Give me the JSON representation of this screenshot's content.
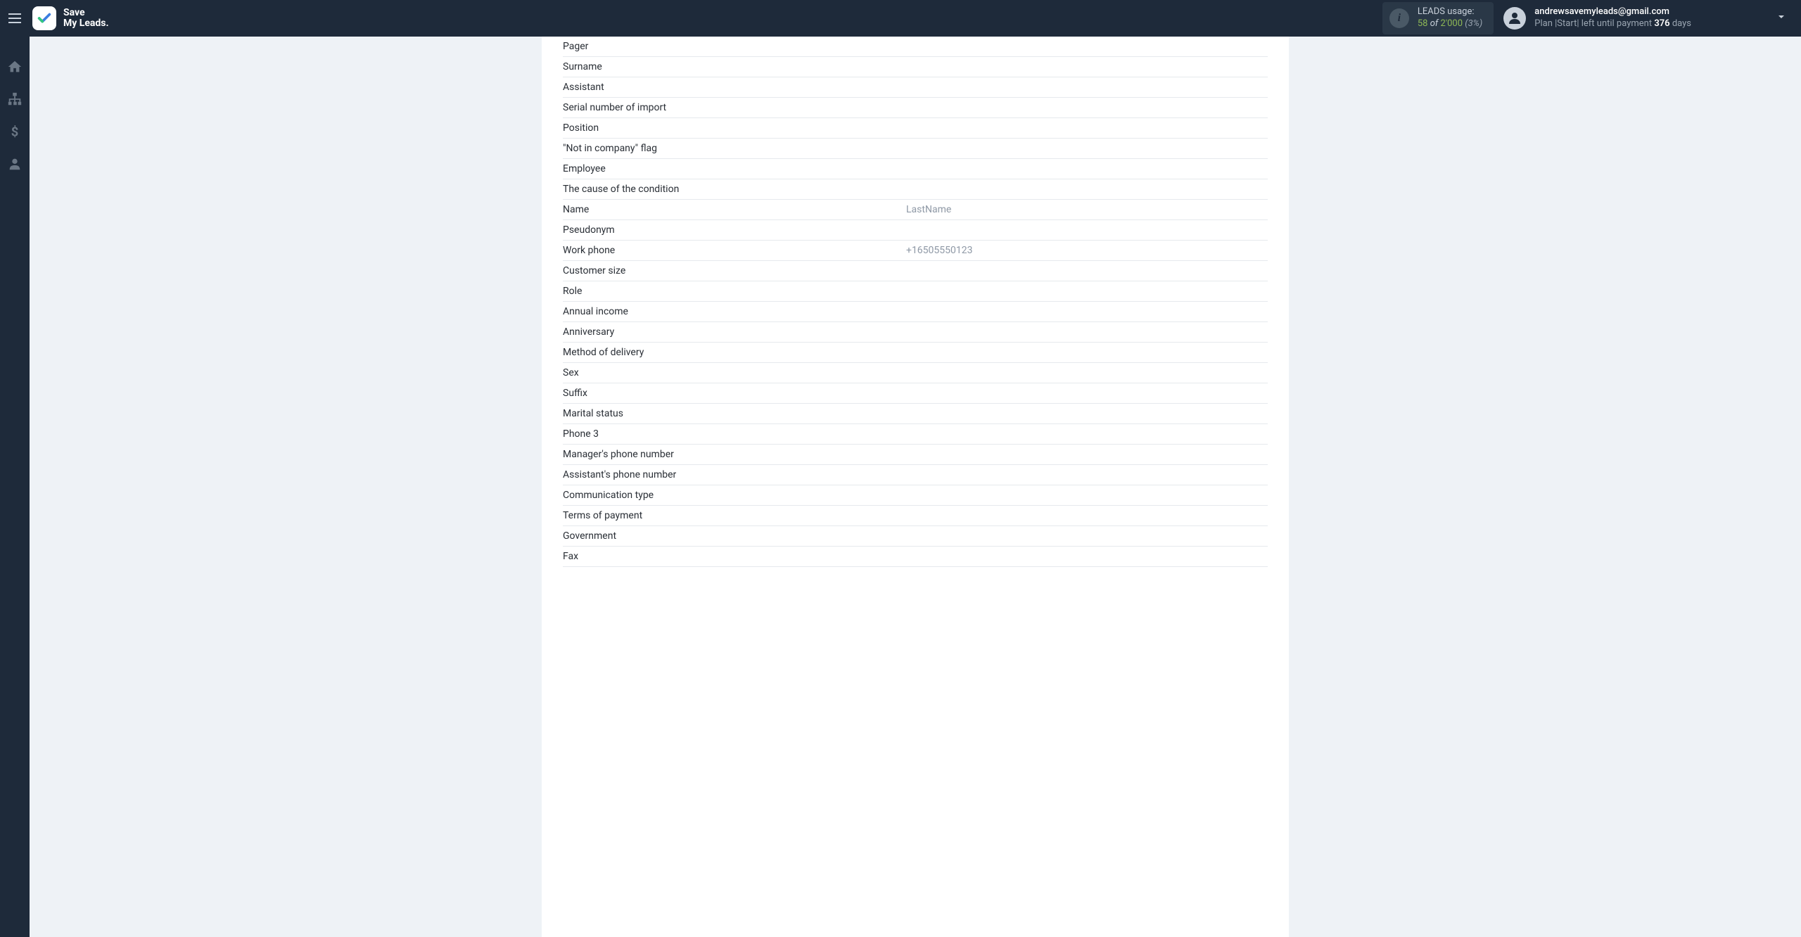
{
  "brand": {
    "line1": "Save",
    "line2": "My Leads."
  },
  "usage": {
    "label": "LEADS usage:",
    "current": "58",
    "of": "of",
    "max": "2'000",
    "pct": "(3%)"
  },
  "account": {
    "email": "andrewsavemyleads@gmail.com",
    "plan_prefix": "Plan |Start| left until payment ",
    "days": "376",
    "days_suffix": " days"
  },
  "fields": [
    {
      "label": "Pager",
      "value": ""
    },
    {
      "label": "Surname",
      "value": ""
    },
    {
      "label": "Assistant",
      "value": ""
    },
    {
      "label": "Serial number of import",
      "value": ""
    },
    {
      "label": "Position",
      "value": ""
    },
    {
      "label": "\"Not in company\" flag",
      "value": ""
    },
    {
      "label": "Employee",
      "value": ""
    },
    {
      "label": "The cause of the condition",
      "value": ""
    },
    {
      "label": "Name",
      "value": "LastName"
    },
    {
      "label": "Pseudonym",
      "value": ""
    },
    {
      "label": "Work phone",
      "value": "+16505550123"
    },
    {
      "label": "Customer size",
      "value": ""
    },
    {
      "label": "Role",
      "value": ""
    },
    {
      "label": "Annual income",
      "value": ""
    },
    {
      "label": "Anniversary",
      "value": ""
    },
    {
      "label": "Method of delivery",
      "value": ""
    },
    {
      "label": "Sex",
      "value": ""
    },
    {
      "label": "Suffix",
      "value": ""
    },
    {
      "label": "Marital status",
      "value": ""
    },
    {
      "label": "Phone 3",
      "value": ""
    },
    {
      "label": "Manager's phone number",
      "value": ""
    },
    {
      "label": "Assistant's phone number",
      "value": ""
    },
    {
      "label": "Communication type",
      "value": ""
    },
    {
      "label": "Terms of payment",
      "value": ""
    },
    {
      "label": "Government",
      "value": ""
    },
    {
      "label": "Fax",
      "value": ""
    }
  ]
}
